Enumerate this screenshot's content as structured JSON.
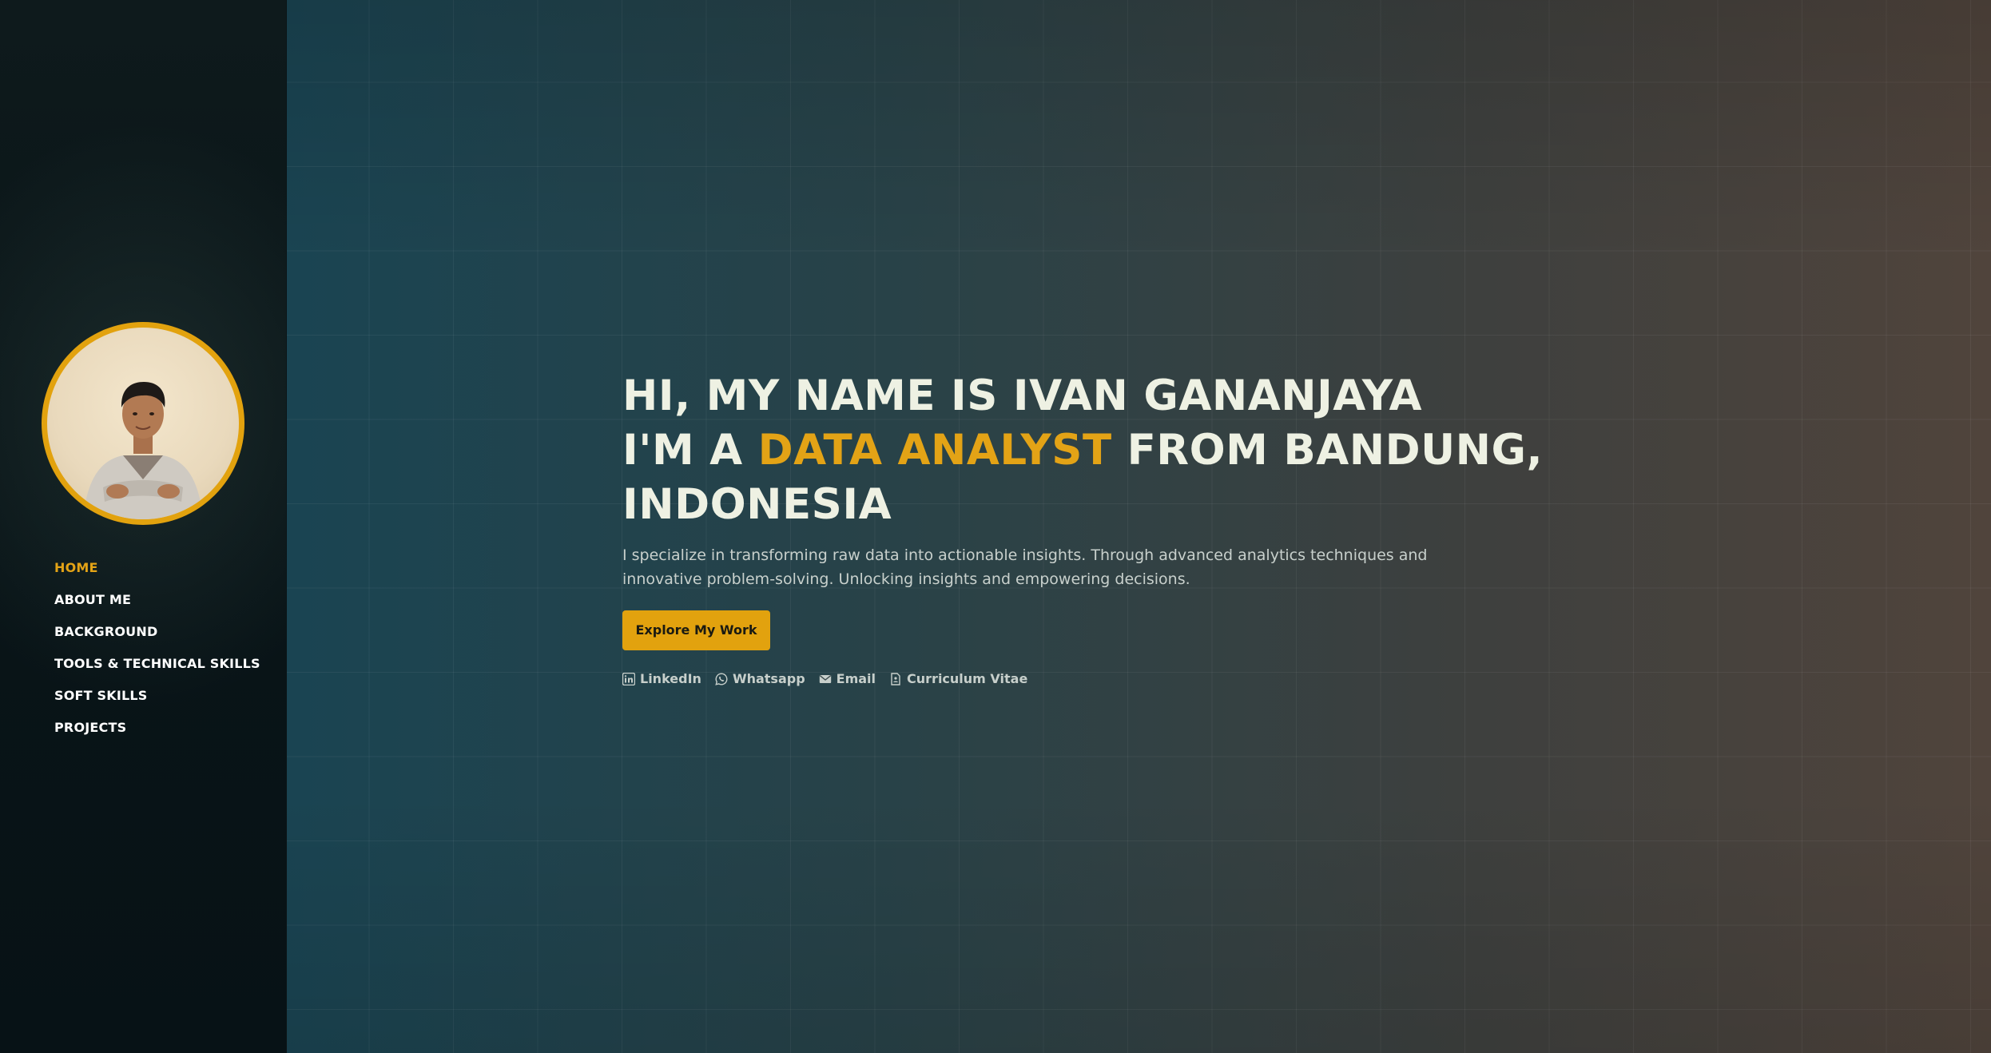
{
  "sidebar": {
    "nav": [
      {
        "label": "HOME"
      },
      {
        "label": "ABOUT ME"
      },
      {
        "label": "BACKGROUND"
      },
      {
        "label": "TOOLS & TECHNICAL SKILLS"
      },
      {
        "label": "SOFT SKILLS"
      },
      {
        "label": "PROJECTS"
      }
    ],
    "active_index": 0
  },
  "hero": {
    "line1": "HI, MY NAME IS IVAN GANANJAYA",
    "line2_prefix": "I'M A ",
    "line2_highlight": "DATA ANALYST",
    "line2_suffix": " FROM BANDUNG,",
    "line3": "INDONESIA",
    "description": "I specialize in transforming raw data into actionable insights. Through advanced analytics techniques and innovative problem-solving. Unlocking insights and empowering decisions.",
    "cta_label": "Explore My Work",
    "links": [
      {
        "icon": "linkedin-icon",
        "label": "LinkedIn"
      },
      {
        "icon": "whatsapp-icon",
        "label": "Whatsapp"
      },
      {
        "icon": "email-icon",
        "label": "Email"
      },
      {
        "icon": "document-icon",
        "label": "Curriculum Vitae"
      }
    ]
  },
  "colors": {
    "accent": "#e3a316",
    "heading": "#eef1e3",
    "sidebar_bg": "#0a1518"
  }
}
